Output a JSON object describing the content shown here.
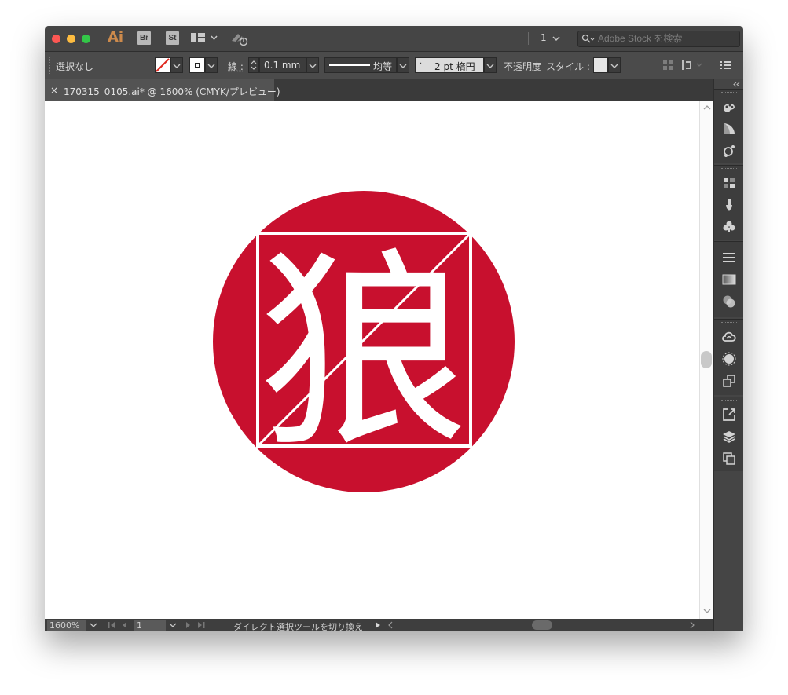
{
  "titlebar": {
    "app_logo": "Ai",
    "bridge_icon": "Br",
    "stock_icon": "St",
    "page_number": "1",
    "search_placeholder": "Adobe Stock を検索"
  },
  "controlbar": {
    "selection_label": "選択なし",
    "stroke_label": "線 :",
    "stroke_weight": "0.1 mm",
    "profile_label": "均等",
    "brush_label": "2 pt 楕円",
    "opacity_label": "不透明度",
    "style_label": "スタイル :"
  },
  "document": {
    "tab_title": "170315_0105.ai* @ 1600% (CMYK/プレビュー)",
    "close_glyph": "×"
  },
  "artwork": {
    "glyph": "狼",
    "circle_color": "#c8102e",
    "glyph_color": "#ffffff"
  },
  "statusbar": {
    "zoom": "1600%",
    "artboard_number": "1",
    "status_text": "ダイレクト選択ツールを切り換え"
  },
  "colors": {
    "window_bg": "#535353",
    "titlebar_bg": "#454545",
    "accent_ai": "#cc8a4c",
    "close": "#fc5753",
    "minimize": "#fdbc40",
    "zoom": "#33c748"
  }
}
